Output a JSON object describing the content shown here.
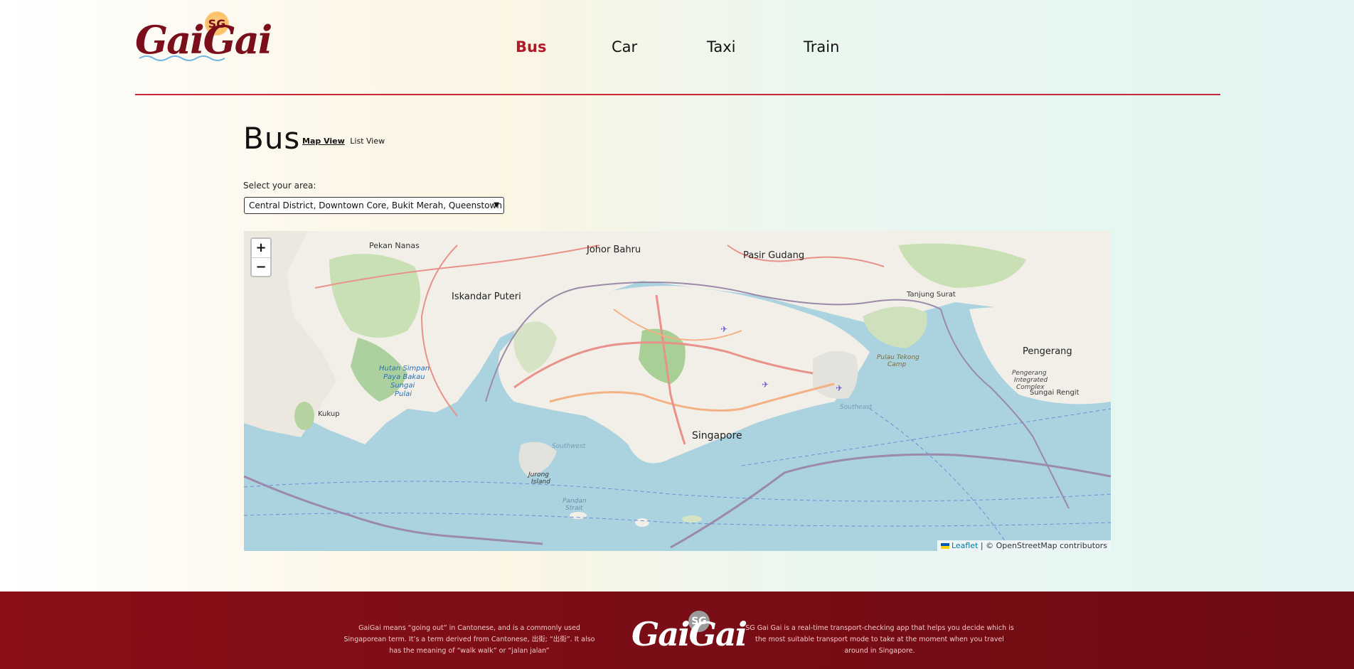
{
  "brand": {
    "logo_text": "GaiGai",
    "logo_badge": "SG"
  },
  "nav": {
    "items": [
      {
        "label": "Bus",
        "active": true
      },
      {
        "label": "Car",
        "active": false
      },
      {
        "label": "Taxi",
        "active": false
      },
      {
        "label": "Train",
        "active": false
      }
    ]
  },
  "page": {
    "title": "Bus",
    "views": [
      {
        "label": "Map View",
        "active": true
      },
      {
        "label": "List View",
        "active": false
      }
    ],
    "area_label": "Select your area:",
    "area_selected": "Central District, Downtown Core, Bukit Merah, Queenstown"
  },
  "map": {
    "zoom_in": "+",
    "zoom_out": "−",
    "attribution_leaflet": "Leaflet",
    "attribution_rest": " | © OpenStreetMap contributors",
    "labels": {
      "johor_bahru": "Johor Bahru",
      "pasir_gudang": "Pasir Gudang",
      "iskandar_puteri": "Iskandar Puteri",
      "pekan_nanas": "Pekan Nanas",
      "tanjung_surat": "Tanjung Surat",
      "pengerang": "Pengerang",
      "sungai_rengit": "Sungai Rengit",
      "singapore": "Singapore",
      "kukup": "Kukup",
      "jurong_island": "Jurong Island",
      "pulau_tekong": "Pulau Tekong Camp",
      "hutan": "Hutan Simpan Paya Bakau Sungai Pulai",
      "pengerang_complex": "Pengerang Integrated Complex",
      "southwest": "Southwest",
      "southeast": "Southeast",
      "pandan": "Pandan Strait"
    },
    "colors": {
      "water": "#aad3df",
      "land": "#f2efe9",
      "green": "#add19e",
      "road": "#e8928a",
      "border": "#9b8aa8"
    }
  },
  "footer": {
    "left_text": "GaiGai means “going out” in Cantonese, and is a commonly used Singaporean term. It’s a term derived from Cantonese, 出街; “出街”. It also has the meaning of “walk walk” or “jalan jalan”",
    "right_text": "SG Gai Gai is a real-time transport-checking app that helps you decide which is the most suitable transport mode to take at the moment when you travel around in Singapore.",
    "logo_text": "GaiGai",
    "logo_badge": "SG"
  }
}
